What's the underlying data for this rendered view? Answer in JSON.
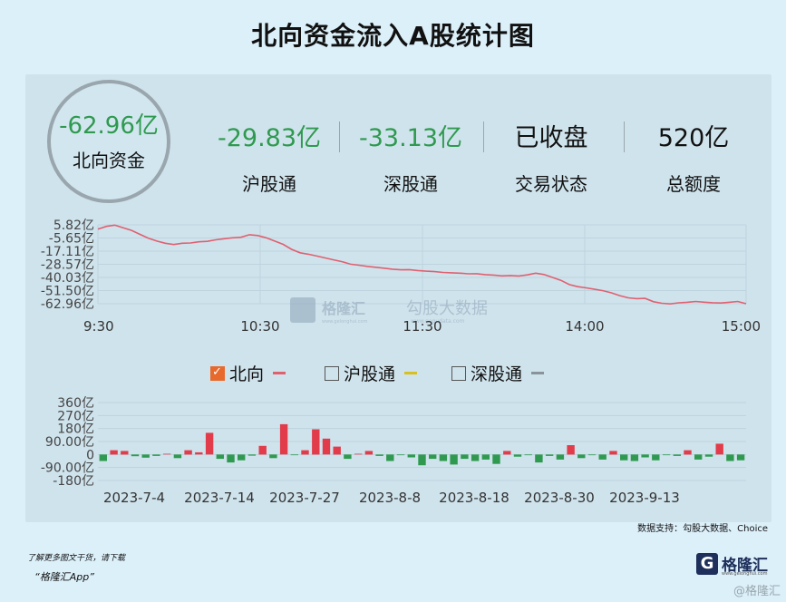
{
  "title": "北向资金流入A股统计图",
  "summary": {
    "main": {
      "value": "-62.96亿",
      "label": "北向资金"
    },
    "items": [
      {
        "value": "-29.83亿",
        "label": "沪股通",
        "color": "#2f9a4f"
      },
      {
        "value": "-33.13亿",
        "label": "深股通",
        "color": "#2f9a4f"
      },
      {
        "value": "已收盘",
        "label": "交易状态",
        "color": "#111111"
      },
      {
        "value": "520亿",
        "label": "总额度",
        "color": "#111111"
      }
    ]
  },
  "watermark": {
    "brand": "格隆汇",
    "brand_sub": "www.gelonghui.com",
    "data": "勾股大数据",
    "data_sub": "www.gogudata.com"
  },
  "legend": [
    {
      "label": "北向",
      "checked": true,
      "color": "#e06070"
    },
    {
      "label": "沪股通",
      "checked": false,
      "color": "#d8c020"
    },
    {
      "label": "深股通",
      "checked": false,
      "color": "#8a9399"
    }
  ],
  "source": "数据支持：勾股大数据、Choice",
  "footer": {
    "line1": "了解更多图文干货，请下载",
    "line2": "“格隆汇App”"
  },
  "corner_watermark": "@格隆汇",
  "chart_data": [
    {
      "type": "line",
      "series": [
        {
          "name": "北向",
          "color": "#e06070",
          "values": [
            2.0,
            4.5,
            5.6,
            3.2,
            1.0,
            -2.5,
            -5.8,
            -8.3,
            -10.2,
            -11.3,
            -10.2,
            -10.0,
            -9.0,
            -8.6,
            -7.2,
            -6.3,
            -5.5,
            -5.0,
            -2.8,
            -3.5,
            -5.5,
            -8.3,
            -11.2,
            -15.5,
            -18.5,
            -19.8,
            -21.4,
            -23.0,
            -24.7,
            -26.3,
            -28.5,
            -29.4,
            -30.4,
            -31.2,
            -32.0,
            -32.8,
            -33.4,
            -33.2,
            -34.0,
            -34.6,
            -35.0,
            -35.7,
            -36.0,
            -36.3,
            -36.9,
            -36.8,
            -37.6,
            -38.0,
            -38.7,
            -38.4,
            -38.8,
            -37.8,
            -36.3,
            -37.5,
            -40.0,
            -42.6,
            -46.3,
            -48.1,
            -49.1,
            -50.4,
            -51.6,
            -53.5,
            -55.9,
            -57.8,
            -58.5,
            -58.3,
            -61.2,
            -62.6,
            -63.1,
            -62.2,
            -61.7,
            -61.0,
            -61.6,
            -62.1,
            -62.3,
            -61.7,
            -61.0,
            -62.96
          ]
        }
      ],
      "x_ticks": [
        "9:30",
        "10:30",
        "11:30",
        "14:00",
        "15:00"
      ],
      "y_ticks": [
        "5.82亿",
        "-5.65亿",
        "-17.11亿",
        "-28.57亿",
        "-40.03亿",
        "-51.50亿",
        "-62.96亿"
      ],
      "ylim": [
        -62.96,
        5.82
      ],
      "grid": true
    },
    {
      "type": "bar",
      "series": [
        {
          "name": "北向",
          "values": [
            -45,
            30,
            25,
            -12,
            -22,
            -10,
            5,
            -25,
            30,
            15,
            150,
            -30,
            -55,
            -40,
            -8,
            60,
            -25,
            210,
            -5,
            30,
            175,
            110,
            55,
            -30,
            5,
            25,
            -10,
            -45,
            -5,
            -20,
            -75,
            -30,
            -45,
            -70,
            -30,
            -45,
            -35,
            -65,
            25,
            -15,
            -5,
            -55,
            -10,
            -35,
            65,
            -25,
            -5,
            -35,
            25,
            -40,
            -45,
            -20,
            -40,
            -5,
            -10,
            30,
            -35,
            -15,
            75,
            -45,
            -40
          ]
        }
      ],
      "x_ticks": [
        "2023-7-4",
        "2023-7-14",
        "2023-7-27",
        "2023-8-8",
        "2023-8-18",
        "2023-8-30",
        "2023-9-13"
      ],
      "y_ticks": [
        "360亿",
        "270亿",
        "180亿",
        "90.00亿",
        "0",
        "-90.00亿",
        "-180亿"
      ],
      "ylim": [
        -180,
        360
      ],
      "positive_color": "#e23b4a",
      "negative_color": "#2f9a4f",
      "grid": true
    }
  ]
}
